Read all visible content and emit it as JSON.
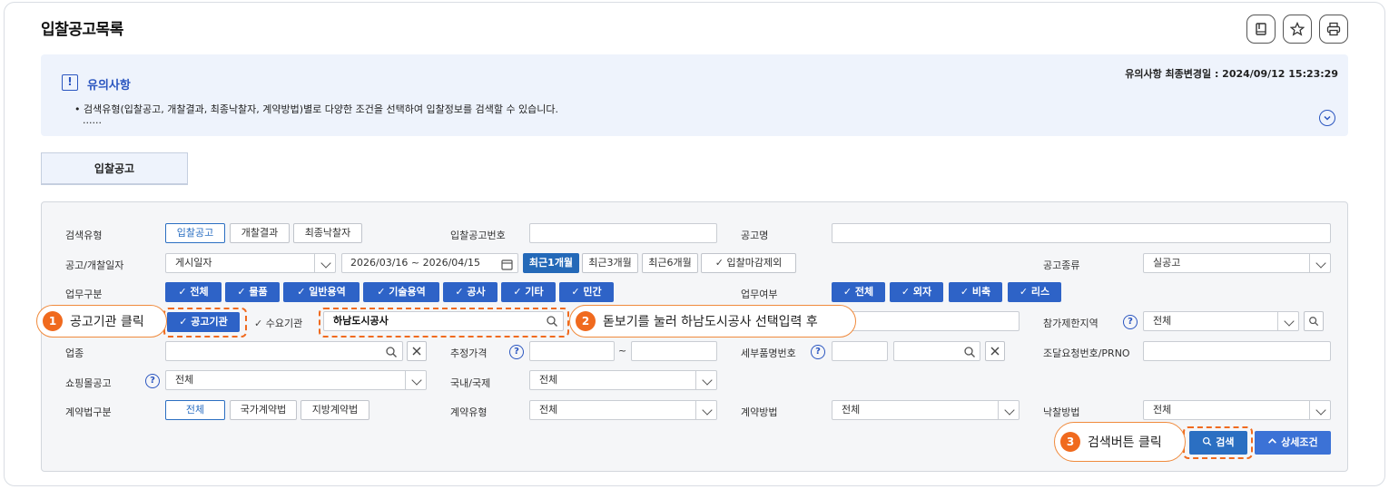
{
  "page": {
    "title": "입찰공고목록"
  },
  "toolbar": {
    "icons": [
      "bookmark-icon",
      "star-icon",
      "print-icon"
    ]
  },
  "notice": {
    "title": "유의사항",
    "date_label": "유의사항 최종변경일 : 2024/09/12 15:23:29",
    "line1": "• 검색유형(입찰공고, 개찰결과, 최종낙찰자, 계약방법)별로 다양한 조건을 선택하여 입찰정보를 검색할 수 있습니다.",
    "line2": "......"
  },
  "tabs": [
    {
      "label": "입찰공고",
      "active": true
    }
  ],
  "form": {
    "search_type": {
      "label": "검색유형",
      "options": [
        "입찰공고",
        "개찰결과",
        "최종낙찰자"
      ],
      "selected": "입찰공고"
    },
    "bid_no": {
      "label": "입찰공고번호",
      "value": ""
    },
    "notice_name": {
      "label": "공고명",
      "value": ""
    },
    "date": {
      "label": "공고/개찰일자",
      "type_value": "게시일자",
      "range": "2026/03/16  ~  2026/04/15",
      "quick": [
        "최근1개월",
        "최근3개월",
        "최근6개월"
      ],
      "quick_selected": "최근1개월",
      "exclude_label": "입찰마감제외"
    },
    "notice_kind": {
      "label": "공고종류",
      "value": "실공고"
    },
    "work_category": {
      "label": "업무구분",
      "options": [
        "전체",
        "물품",
        "일반용역",
        "기술용역",
        "공사",
        "기타",
        "민간"
      ]
    },
    "work_yn": {
      "label": "업무여부",
      "options": [
        "전체",
        "외자",
        "비축",
        "리스"
      ]
    },
    "agency": {
      "options": [
        "공고기관",
        "수요기관"
      ],
      "selected": "공고기관",
      "value": "하남도시공사"
    },
    "region": {
      "label": "참가제한지역",
      "value": "전체"
    },
    "industry": {
      "label": "업종"
    },
    "est_price": {
      "label": "추정가격",
      "sep": "~"
    },
    "item_no": {
      "label": "세부품명번호"
    },
    "request_no": {
      "label": "조달요청번호/PRNO"
    },
    "mall": {
      "label": "쇼핑몰공고",
      "value": "전체"
    },
    "domestic": {
      "label": "국내/국제",
      "value": "전체"
    },
    "contract_law": {
      "label": "계약법구분",
      "options": [
        "전체",
        "국가계약법",
        "지방계약법"
      ],
      "selected": "전체"
    },
    "contract_type": {
      "label": "계약유형",
      "value": "전체"
    },
    "contract_method": {
      "label": "계약방법",
      "value": "전체"
    },
    "award_method": {
      "label": "낙찰방법",
      "value": "전체"
    },
    "search_label": "검색",
    "detail_label": "상세조건"
  },
  "callouts": [
    {
      "num": "1",
      "text": "공고기관 클릭"
    },
    {
      "num": "2",
      "text": "돋보기를 눌러 하남도시공사 선택입력 후"
    },
    {
      "num": "3",
      "text": "검색버튼 클릭"
    }
  ],
  "colors": {
    "accent": "#2b6fc2",
    "checkbox": "#2e63c7",
    "callout": "#f06a1e",
    "notice_bg": "#eef3fc"
  }
}
